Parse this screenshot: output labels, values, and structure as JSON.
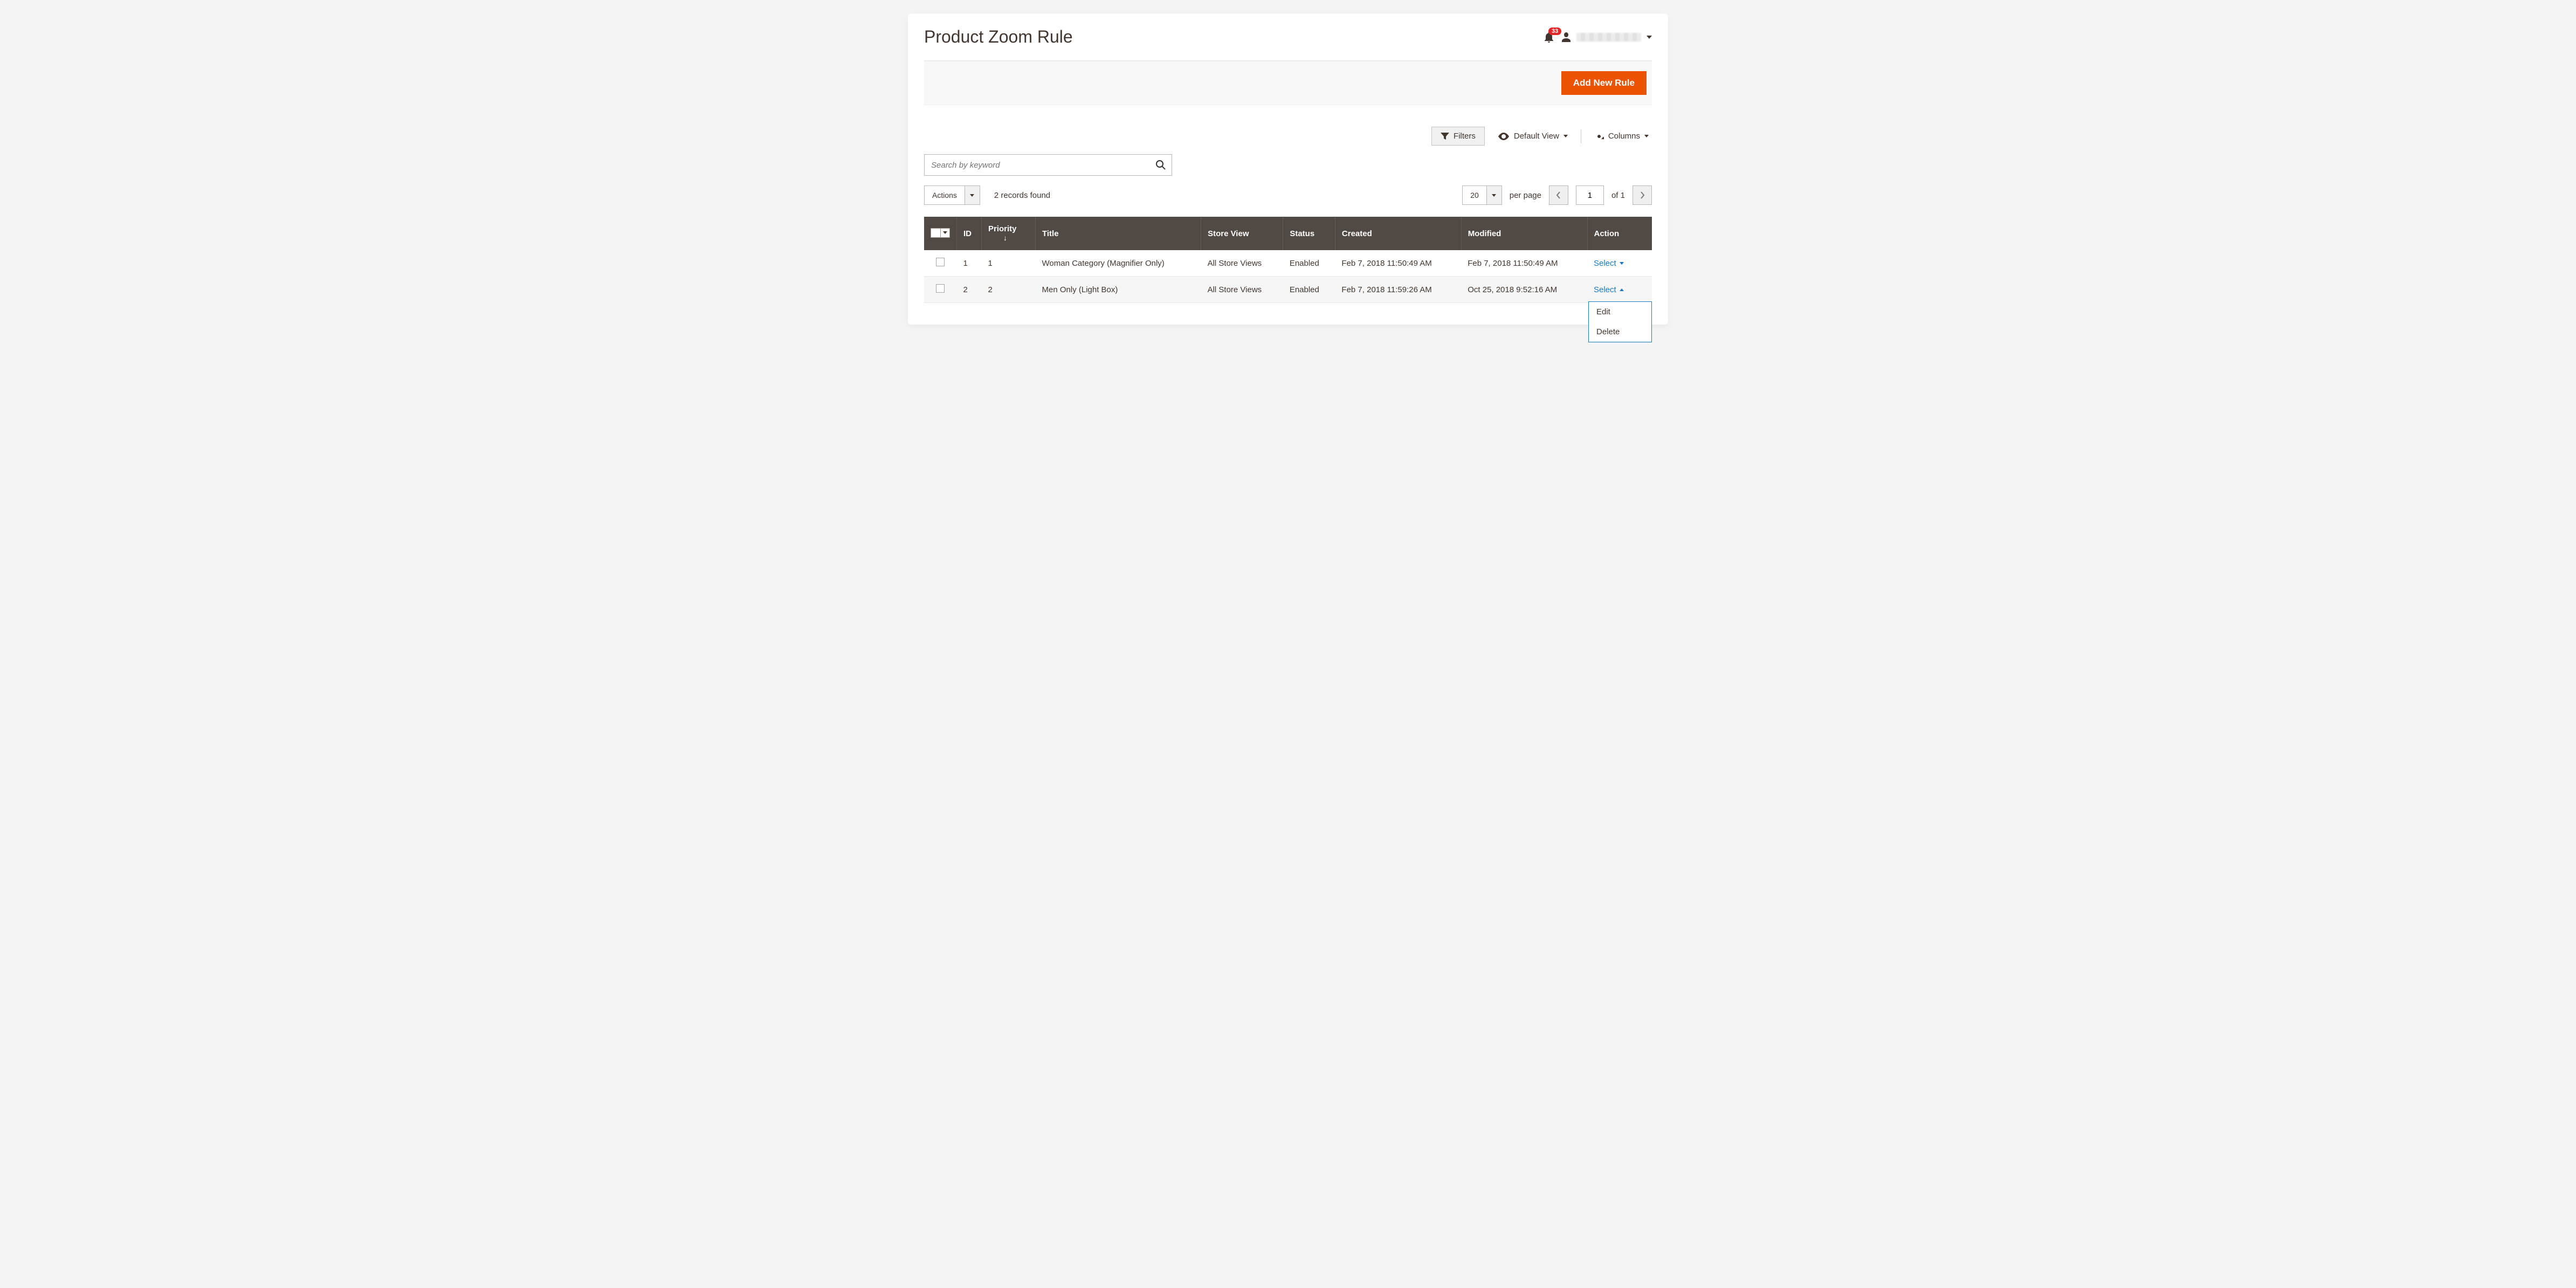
{
  "page_title": "Product Zoom Rule",
  "notifications_count": "33",
  "add_button": "Add New Rule",
  "toolbar": {
    "filters": "Filters",
    "default_view": "Default View",
    "columns": "Columns"
  },
  "search": {
    "placeholder": "Search by keyword"
  },
  "grid_controls": {
    "actions_label": "Actions",
    "records_found": "2 records found",
    "per_page_value": "20",
    "per_page_label": "per page",
    "page_value": "1",
    "of_label": "of 1"
  },
  "columns": {
    "id": "ID",
    "priority": "Priority",
    "title": "Title",
    "store_view": "Store View",
    "status": "Status",
    "created": "Created",
    "modified": "Modified",
    "action": "Action"
  },
  "rows": [
    {
      "id": "1",
      "priority": "1",
      "title": "Woman Category (Magnifier Only)",
      "store_view": "All Store Views",
      "status": "Enabled",
      "created": "Feb 7, 2018 11:50:49 AM",
      "modified": "Feb 7, 2018 11:50:49 AM",
      "action": "Select",
      "dropdown_open": false
    },
    {
      "id": "2",
      "priority": "2",
      "title": "Men Only (Light Box)",
      "store_view": "All Store Views",
      "status": "Enabled",
      "created": "Feb 7, 2018 11:59:26 AM",
      "modified": "Oct 25, 2018 9:52:16 AM",
      "action": "Select",
      "dropdown_open": true
    }
  ],
  "action_menu": {
    "edit": "Edit",
    "delete": "Delete"
  }
}
